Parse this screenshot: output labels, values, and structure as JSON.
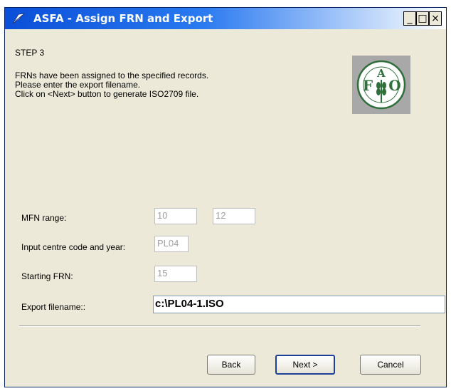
{
  "window": {
    "title": "ASFA - Assign FRN and Export",
    "minimize_glyph": "_",
    "maximize_glyph": "□",
    "close_glyph": "×"
  },
  "step": {
    "label": "STEP 3",
    "instructions": [
      "FRNs have been assigned to the specified records.",
      "Please enter the export filename.",
      "Click on <Next> button to generate ISO2709 file."
    ]
  },
  "logo": {
    "letters": [
      "F",
      "A",
      "O"
    ],
    "motto": "FIAT PANIS"
  },
  "form": {
    "mfn_range_label": "MFN range:",
    "mfn_from": "10",
    "mfn_to": "12",
    "centre_label": "Input centre code and year:",
    "centre_value": "PL04",
    "starting_frn_label": "Starting FRN:",
    "starting_frn_value": "15",
    "export_filename_label": "Export filename::",
    "export_filename_value": "c:\\PL04-1.ISO"
  },
  "buttons": {
    "back": "Back",
    "next": "Next >",
    "cancel": "Cancel"
  }
}
